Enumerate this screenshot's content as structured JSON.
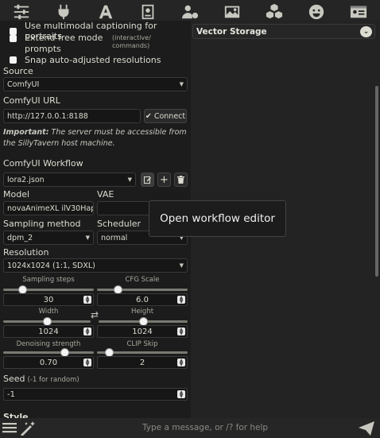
{
  "toolbar": {
    "icons": [
      "sliders-icon",
      "plug-icon",
      "font-icon",
      "book-icon",
      "user-gear-icon",
      "image-icon",
      "cubes-icon",
      "smile-icon",
      "id-card-icon"
    ]
  },
  "options": {
    "multimodal_captioning": "Use multimodal captioning for portraits",
    "extend_free_mode": "Extend free mode prompts",
    "extend_free_mode_hint": "(interactive/ commands)",
    "snap_resolutions": "Snap auto-adjusted resolutions"
  },
  "source": {
    "label": "Source",
    "value": "ComfyUI"
  },
  "comfy_url": {
    "label": "ComfyUI URL",
    "value": "http://127.0.0.1:8188",
    "connect_label": "Connect"
  },
  "note": {
    "important": "Important:",
    "text": " The server must be accessible from the SillyTavern host machine."
  },
  "workflow": {
    "label": "ComfyUI Workflow",
    "value": "lora2.json"
  },
  "model": {
    "label": "Model",
    "value": "novaAnimeXL ilV30Happ"
  },
  "vae": {
    "label": "VAE"
  },
  "sampling": {
    "label": "Sampling method",
    "value": "dpm_2"
  },
  "scheduler": {
    "label": "Scheduler",
    "value": "normal"
  },
  "resolution": {
    "label": "Resolution",
    "value": "1024x1024 (1:1, SDXL)"
  },
  "sliders": {
    "steps_label": "Sampling steps",
    "steps_value": "30",
    "steps_fraction": 0.18,
    "cfg_label": "CFG Scale",
    "cfg_value": "6.0",
    "cfg_fraction": 0.2,
    "width_label": "Width",
    "width_value": "1024",
    "width_fraction": 0.5,
    "height_label": "Height",
    "height_value": "1024",
    "height_fraction": 0.5,
    "denoise_label": "Denoising strength",
    "denoise_value": "0.70",
    "denoise_fraction": 0.7,
    "clip_label": "CLIP Skip",
    "clip_value": "2",
    "clip_fraction": 0.1
  },
  "seed": {
    "label": "Seed",
    "hint": "(-1 for random)",
    "value": "-1"
  },
  "style": {
    "label": "Style"
  },
  "tooltip": {
    "text": "Open workflow editor"
  },
  "vector": {
    "header": "Vector Storage"
  },
  "chat": {
    "placeholder": "Type a message, or /? for help"
  }
}
